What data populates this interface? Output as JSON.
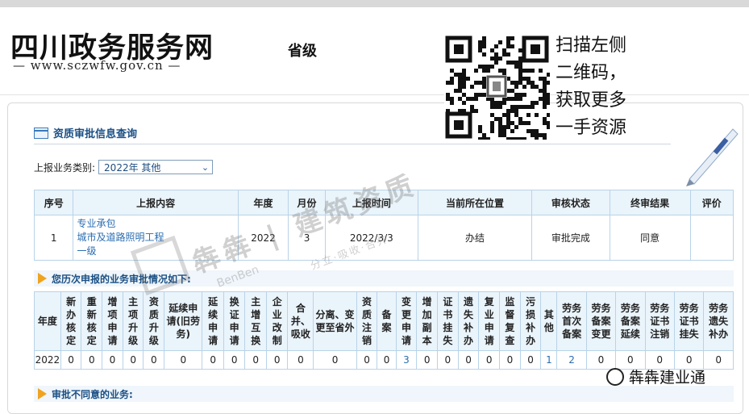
{
  "header": {
    "logo_text": "四川政务服务网",
    "logo_url": "— www.sczwfw.gov.cn —",
    "level": "省级"
  },
  "qr": {
    "line1": "扫描左侧",
    "line2": "二维码，",
    "line3": "获取更多",
    "line4": "一手资源"
  },
  "section_title": "资质审批信息查询",
  "filter": {
    "label": "上报业务类别:",
    "value": "2022年 其他"
  },
  "table1": {
    "headers": [
      "序号",
      "上报内容",
      "年度",
      "月份",
      "上报时间",
      "当前所在位置",
      "审核状态",
      "终审结果",
      "评价"
    ],
    "row": {
      "index": "1",
      "content_l1": "专业承包",
      "content_l2": "城市及道路照明工程",
      "content_l3": "一级",
      "year": "2022",
      "month": "3",
      "time": "2022/3/3",
      "location": "办结",
      "status": "审批完成",
      "result": "同意",
      "rating": ""
    }
  },
  "history_title": "您历次申报的业务审批情况如下:",
  "table2": {
    "headers": [
      "年度",
      "新办核定",
      "重新核定",
      "增项申请",
      "主项升级",
      "资质升级",
      "延续申请(旧劳务)",
      "延续申请",
      "换证申请",
      "主增互换",
      "企业改制",
      "合并、吸收",
      "分离、变更至省外",
      "资质注销",
      "备案",
      "变更申请",
      "增加副本",
      "证书挂失",
      "遗失补办",
      "复业申请",
      "监督复查",
      "污损补办",
      "其他",
      "劳务首次备案",
      "劳务备案变更",
      "劳务备案延续",
      "劳务证书注销",
      "劳务证书挂失",
      "劳务遗失补办"
    ],
    "values": [
      "2022",
      "0",
      "0",
      "0",
      "0",
      "0",
      "0",
      "0",
      "0",
      "0",
      "0",
      "0",
      "0",
      "0",
      "0",
      "3",
      "0",
      "0",
      "0",
      "0",
      "0",
      "0",
      "1",
      "2",
      "0",
      "0",
      "0",
      "0",
      "0"
    ]
  },
  "reject_title": "审批不同意的业务:",
  "watermark": {
    "main": "犇犇 | 建筑资质",
    "sub": "分立·吸收·合并",
    "latin": "BenBen"
  },
  "badge": "犇犇建业通",
  "colors": {
    "link": "#2a6db2",
    "header_bg": "#eaf4fb",
    "border": "#b9d3e8",
    "arrow": "#f0a31f"
  }
}
